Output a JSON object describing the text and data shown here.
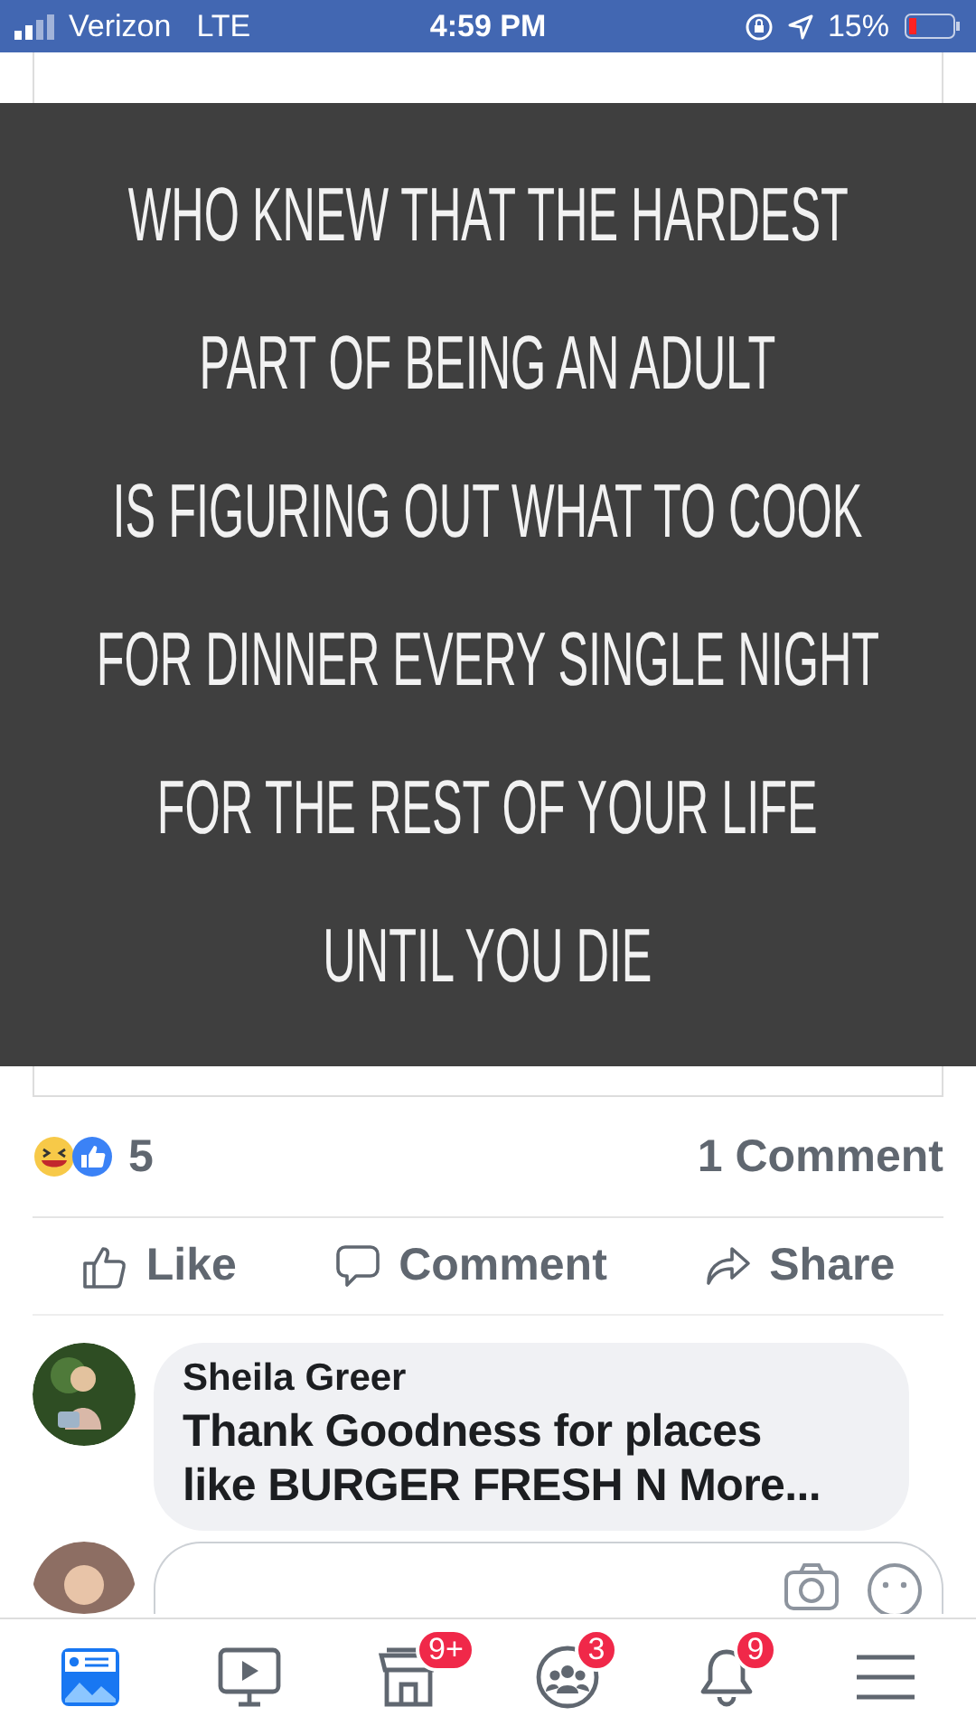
{
  "status_bar": {
    "carrier": "Verizon",
    "network": "LTE",
    "time": "4:59 PM",
    "battery": "15%"
  },
  "post": {
    "image_lines": [
      "WHO KNEW THAT THE HARDEST",
      "PART OF BEING AN ADULT",
      "IS FIGURING OUT WHAT TO COOK",
      "FOR DINNER EVERY SINGLE NIGHT",
      "FOR THE REST OF YOUR LIFE",
      "UNTIL YOU DIE"
    ],
    "reactions_count": "5",
    "comments_count": "1 Comment",
    "actions": [
      {
        "kind": "like",
        "label": "Like"
      },
      {
        "kind": "comment",
        "label": "Comment"
      },
      {
        "kind": "share",
        "label": "Share"
      }
    ]
  },
  "comments": [
    {
      "author": "Sheila Greer",
      "text": "Thank Goodness for places like BURGER FRESH N More..."
    }
  ],
  "bottom_nav": [
    {
      "kind": "feed",
      "selected": true
    },
    {
      "kind": "video",
      "selected": false
    },
    {
      "kind": "marketplace",
      "selected": false,
      "badge": "9+"
    },
    {
      "kind": "groups",
      "selected": false,
      "badge": "3"
    },
    {
      "kind": "notifications",
      "selected": false,
      "badge": "9"
    },
    {
      "kind": "menu",
      "selected": false
    }
  ]
}
